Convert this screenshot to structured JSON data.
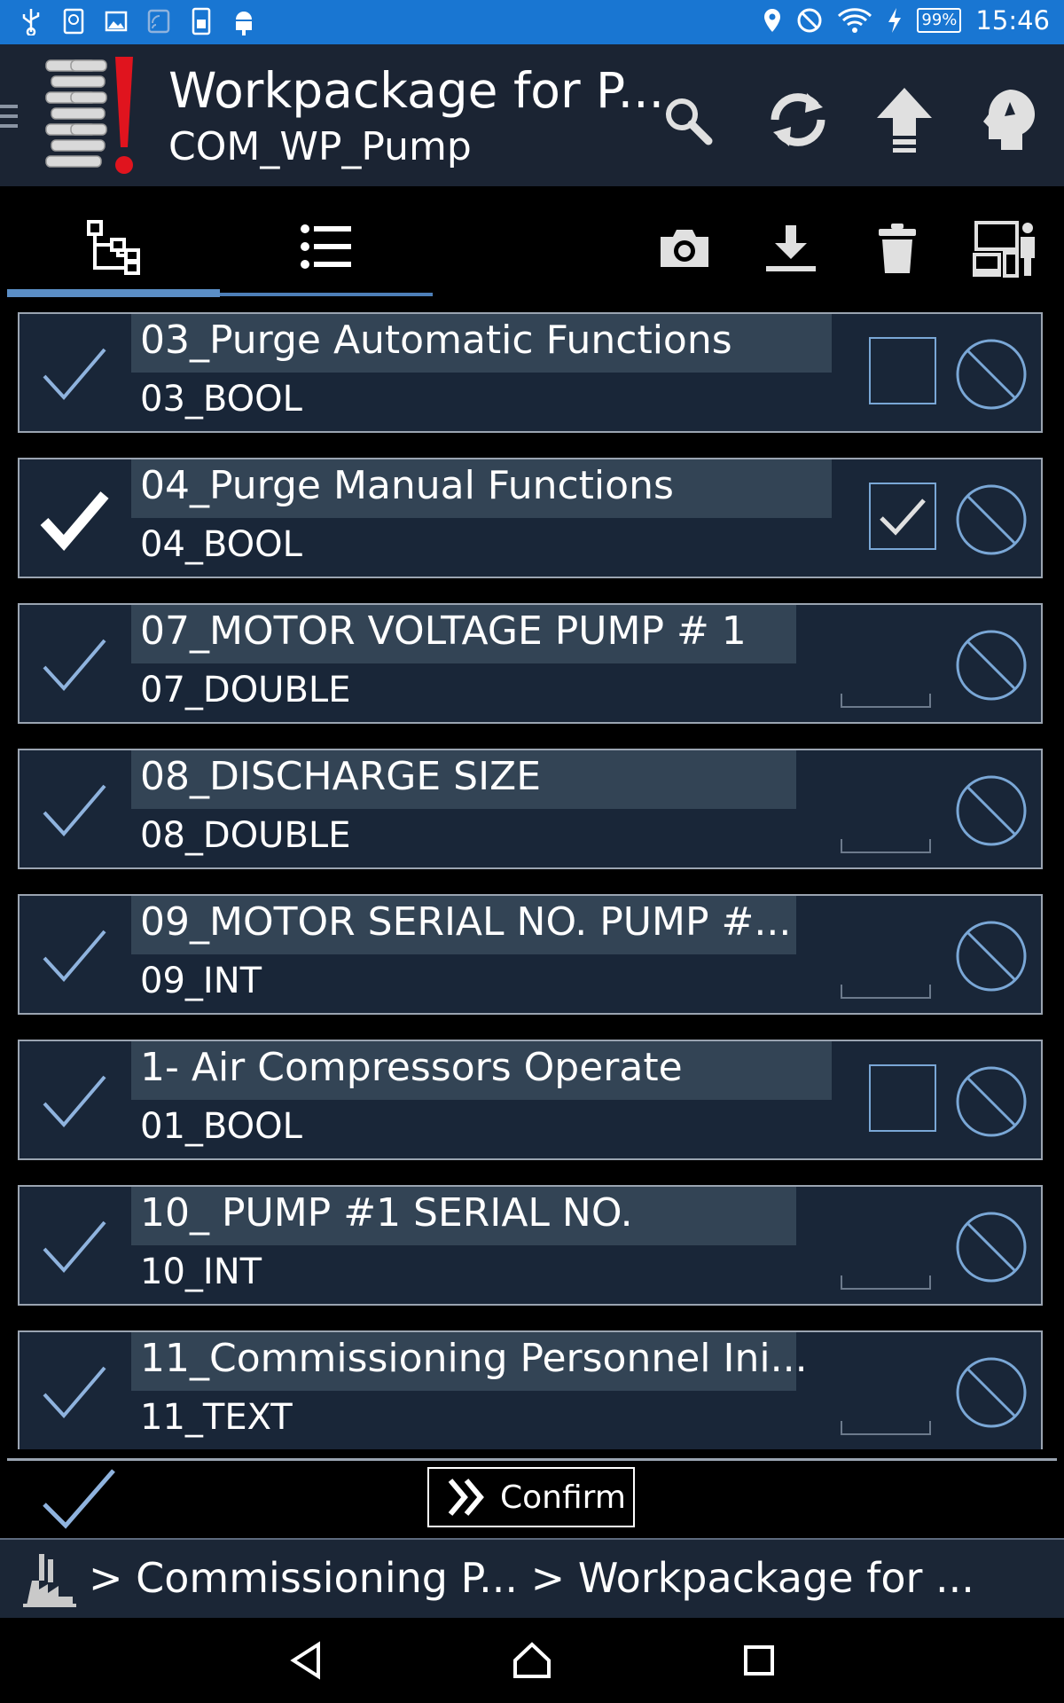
{
  "status_bar": {
    "time": "15:46",
    "battery": "99%",
    "icons_left": [
      "usb-icon",
      "sync-icon",
      "image-icon",
      "cast-icon",
      "sim-icon",
      "android-icon"
    ],
    "icons_right": [
      "location-icon",
      "dnd-icon",
      "wifi-icon",
      "charging-icon",
      "battery-icon"
    ]
  },
  "app_bar": {
    "title": "Workpackage for P...",
    "subtitle": "COM_WP_Pump",
    "actions": [
      "search-icon",
      "refresh-icon",
      "upload-icon",
      "user-settings-icon"
    ]
  },
  "toolbar": {
    "tabs": [
      "tree-view-tab",
      "list-view-tab"
    ],
    "active_tab": 0,
    "actions": [
      "camera-icon",
      "download-icon",
      "delete-icon",
      "devices-icon"
    ]
  },
  "items": [
    {
      "title": "03_Purge Automatic Functions",
      "subtitle": "03_BOOL",
      "done": false,
      "control": "checkbox",
      "checked": false
    },
    {
      "title": "04_Purge Manual Functions",
      "subtitle": "04_BOOL",
      "done": true,
      "control": "checkbox",
      "checked": true
    },
    {
      "title": "07_MOTOR VOLTAGE PUMP # 1",
      "subtitle": "07_DOUBLE",
      "done": false,
      "control": "input",
      "value": ""
    },
    {
      "title": "08_DISCHARGE SIZE",
      "subtitle": "08_DOUBLE",
      "done": false,
      "control": "input",
      "value": ""
    },
    {
      "title": "09_MOTOR SERIAL NO. PUMP #...",
      "subtitle": "09_INT",
      "done": false,
      "control": "input",
      "value": ""
    },
    {
      "title": "1-  Air Compressors Operate",
      "subtitle": "01_BOOL",
      "done": false,
      "control": "checkbox",
      "checked": false
    },
    {
      "title": "10_ PUMP #1 SERIAL NO.",
      "subtitle": "10_INT",
      "done": false,
      "control": "input",
      "value": ""
    },
    {
      "title": "11_Commissioning Personnel Ini...",
      "subtitle": "11_TEXT",
      "done": false,
      "control": "input",
      "value": ""
    }
  ],
  "footer": {
    "confirm_label": "Confirm"
  },
  "breadcrumb": {
    "text": ">  Commissioning P... > Workpackage for ..."
  },
  "colors": {
    "status_bar": "#1976d2",
    "app_bar": "#1b2433",
    "row_bg": "#192638",
    "label_bg": "#334455",
    "accent": "#7aa7d6",
    "logo_red": "#e0141e"
  }
}
